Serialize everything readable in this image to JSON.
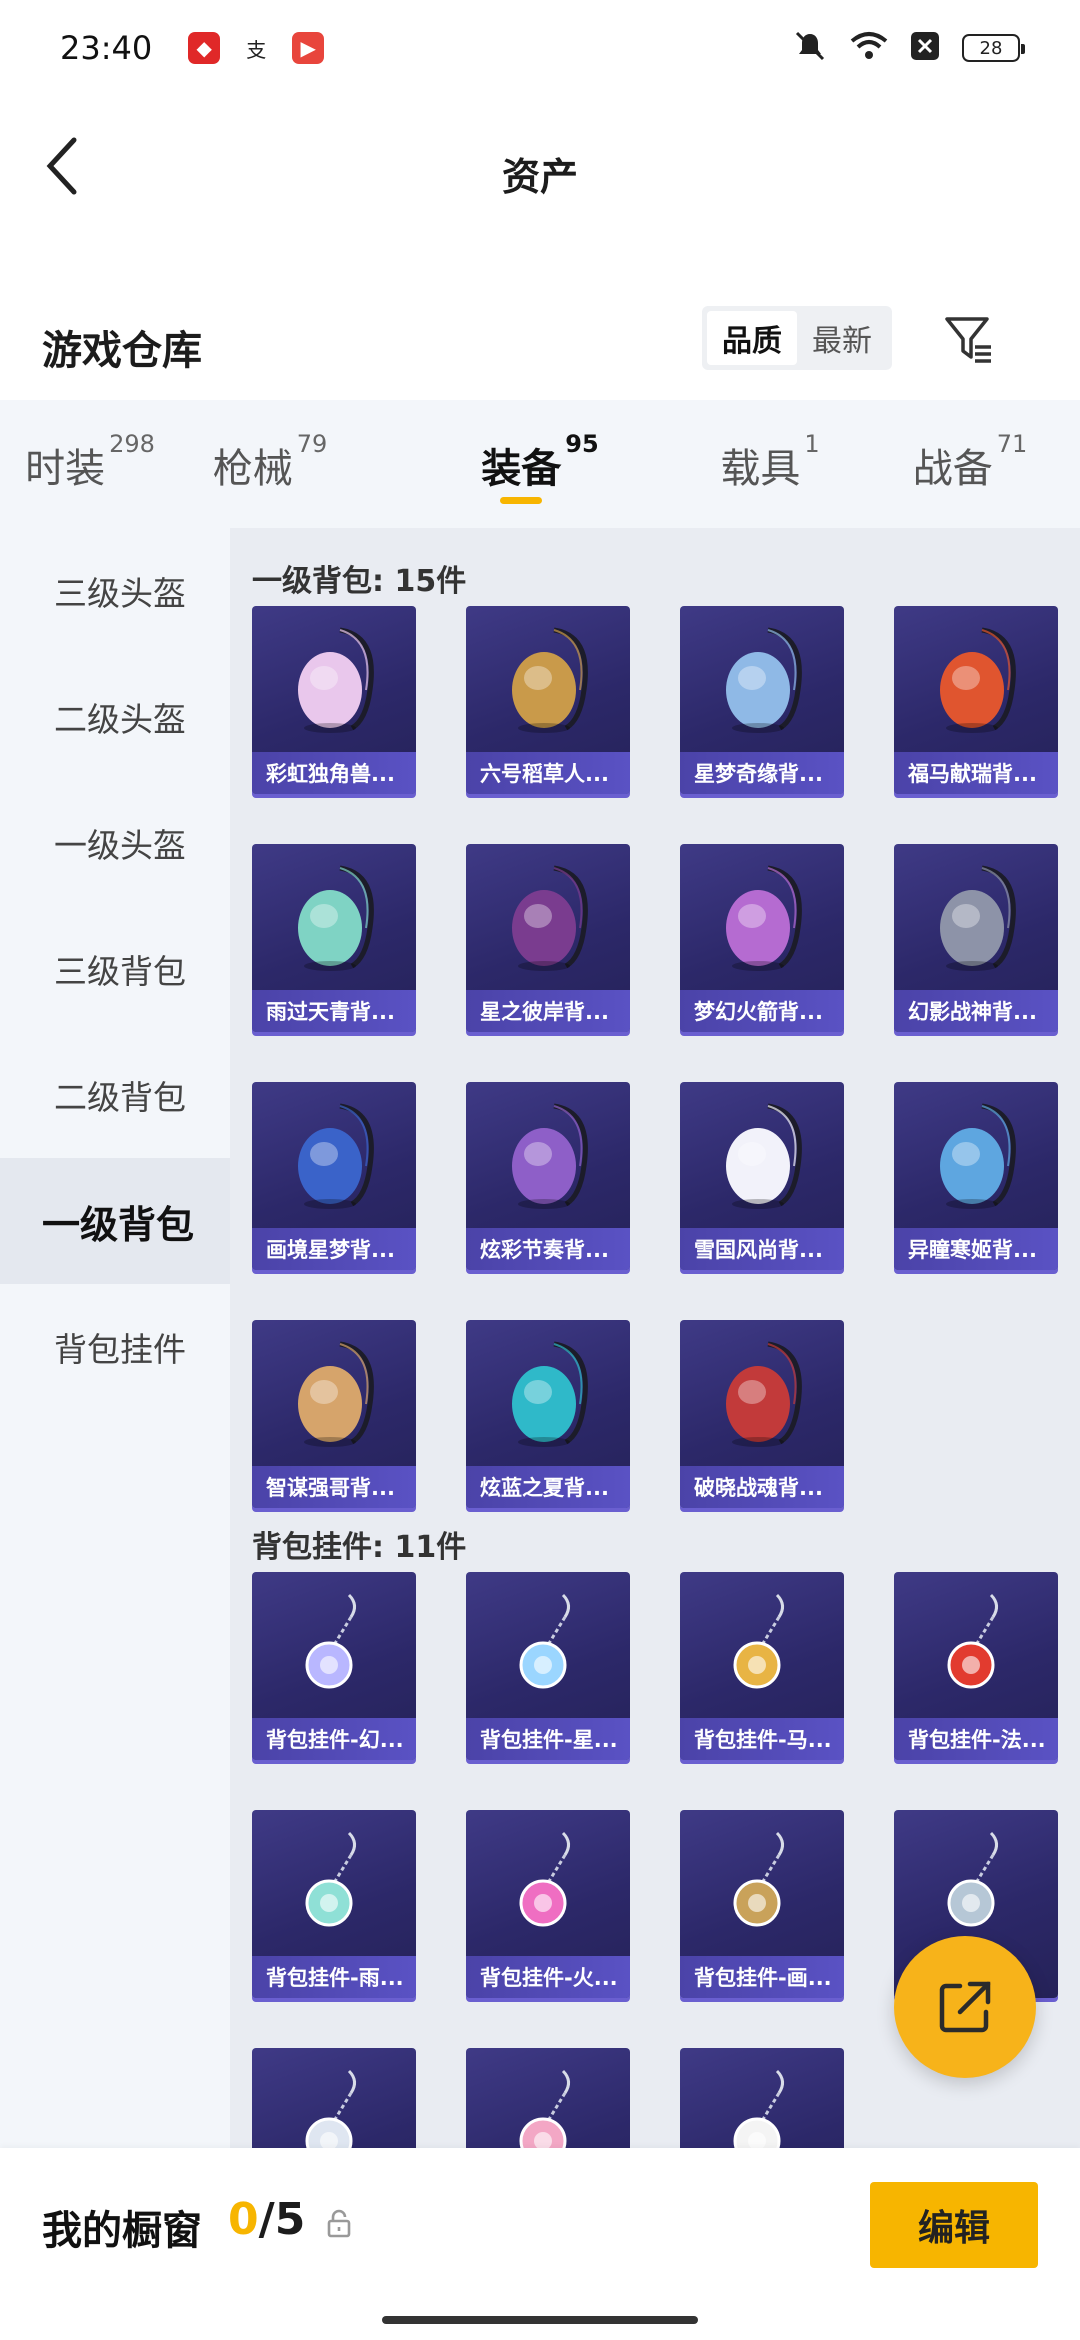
{
  "status": {
    "time": "23:40",
    "battery": "28",
    "apps": [
      {
        "icon": "red-app-icon",
        "color": "#e02828",
        "glyph": "◆"
      },
      {
        "icon": "alipay-icon",
        "color": "#ffffff",
        "glyph": "支"
      },
      {
        "icon": "video-app-icon",
        "color": "#e8453c",
        "glyph": "▶"
      }
    ]
  },
  "header": {
    "title": "资产"
  },
  "warehouse": {
    "title": "游戏仓库",
    "sort_quality": "品质",
    "sort_newest": "最新"
  },
  "tabs": [
    {
      "label": "时装",
      "count": "298"
    },
    {
      "label": "枪械",
      "count": "79"
    },
    {
      "label": "装备",
      "count": "95",
      "active": true
    },
    {
      "label": "载具",
      "count": "1"
    },
    {
      "label": "战备",
      "count": "71"
    }
  ],
  "sidenav": [
    {
      "label": "三级头盔"
    },
    {
      "label": "二级头盔"
    },
    {
      "label": "一级头盔"
    },
    {
      "label": "三级背包"
    },
    {
      "label": "二级背包"
    },
    {
      "label": "一级背包",
      "active": true
    },
    {
      "label": "背包挂件"
    }
  ],
  "sections": [
    {
      "title": "一级背包: 15件",
      "items": [
        {
          "label": "彩虹独角兽...",
          "icon": "unicorn-backpack-icon",
          "color": "#e9c7ec"
        },
        {
          "label": "六号稻草人...",
          "icon": "scarecrow-backpack-icon",
          "color": "#c99a4a"
        },
        {
          "label": "星梦奇缘背...",
          "icon": "swan-backpack-icon",
          "color": "#8fb9e6"
        },
        {
          "label": "福马献瑞背...",
          "icon": "horse-backpack-icon",
          "color": "#e0552f"
        },
        {
          "label": "雨过天青背...",
          "icon": "vase-backpack-icon",
          "color": "#7fd3c4"
        },
        {
          "label": "星之彼岸背...",
          "icon": "astronaut-backpack-icon",
          "color": "#7a3c8f"
        },
        {
          "label": "梦幻火箭背...",
          "icon": "rocket-backpack-icon",
          "color": "#b56bd1"
        },
        {
          "label": "幻影战神背...",
          "icon": "phantom-backpack-icon",
          "color": "#8d93a8"
        },
        {
          "label": "画境星梦背...",
          "icon": "book-backpack-icon",
          "color": "#3a63c9"
        },
        {
          "label": "炫彩节奏背...",
          "icon": "rhythm-backpack-icon",
          "color": "#8e5fc8"
        },
        {
          "label": "雪国风尚背...",
          "icon": "snowman-backpack-icon",
          "color": "#f2f2fa"
        },
        {
          "label": "异瞳寒姬背...",
          "icon": "ice-backpack-icon",
          "color": "#5ea6e0"
        },
        {
          "label": "智谋强哥背...",
          "icon": "bear-backpack-icon",
          "color": "#d6a46b"
        },
        {
          "label": "炫蓝之夏背...",
          "icon": "summer-backpack-icon",
          "color": "#2fb9c9"
        },
        {
          "label": "破晓战魂背...",
          "icon": "dawn-backpack-icon",
          "color": "#c23a3a"
        }
      ]
    },
    {
      "title": "背包挂件: 11件",
      "items": [
        {
          "label": "背包挂件-幻...",
          "icon": "phantom-charm-icon",
          "color": "#b9b7ff"
        },
        {
          "label": "背包挂件-星...",
          "icon": "star-charm-icon",
          "color": "#9bd6ff"
        },
        {
          "label": "背包挂件-马...",
          "icon": "horse-charm-icon",
          "color": "#e8b444"
        },
        {
          "label": "背包挂件-法...",
          "icon": "ferrari-charm-icon",
          "color": "#e23b2f"
        },
        {
          "label": "背包挂件-雨...",
          "icon": "sword-charm-icon",
          "color": "#8fe0d6"
        },
        {
          "label": "背包挂件-火...",
          "icon": "rocket-charm-icon",
          "color": "#ef6ec2"
        },
        {
          "label": "背包挂件-画...",
          "icon": "scroll-charm-icon",
          "color": "#c9a25a"
        },
        {
          "label": "",
          "icon": "bell-charm-icon",
          "color": "#b6c7d6"
        },
        {
          "label": "",
          "icon": "helmet-charm-icon",
          "color": "#dfe6f1"
        },
        {
          "label": "",
          "icon": "pink-charm-icon",
          "color": "#f3a7c5"
        },
        {
          "label": "",
          "icon": "mask-charm-icon",
          "color": "#f4f4f4"
        }
      ]
    }
  ],
  "showcase": {
    "label": "我的橱窗",
    "current": "0",
    "total": "/5",
    "edit_label": "编辑"
  },
  "colors": {
    "accent": "#f7b500",
    "card": "#2c2869",
    "label_bar": "#5a52c4"
  }
}
